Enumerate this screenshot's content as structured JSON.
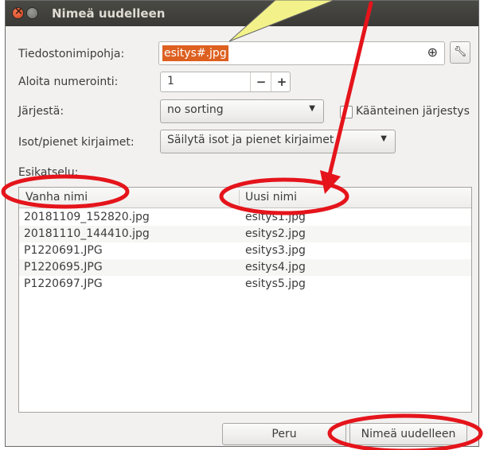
{
  "window": {
    "title": "Nimeä uudelleen"
  },
  "form": {
    "template_label": "Tiedostonimipohja:",
    "template_value": "esitys#.jpg",
    "numbering_label": "Aloita numerointi:",
    "numbering_value": "1",
    "minus": "−",
    "plus": "+",
    "sort_label": "Järjestä:",
    "sort_value": "no sorting",
    "reverse_label": "Käänteinen järjestys",
    "case_label": "Isot/pienet kirjaimet:",
    "case_value": "Säilytä isot ja pienet kirjaimet"
  },
  "preview": {
    "label": "Esikatselu:",
    "columns": [
      "Vanha nimi",
      "Uusi nimi"
    ],
    "rows": [
      {
        "old": "20181109_152820.jpg",
        "new": "esitys1.jpg"
      },
      {
        "old": "20181110_144410.jpg",
        "new": "esitys2.jpg"
      },
      {
        "old": "P1220691.JPG",
        "new": "esitys3.jpg"
      },
      {
        "old": "P1220695.JPG",
        "new": "esitys4.jpg"
      },
      {
        "old": "P1220697.JPG",
        "new": "esitys5.jpg"
      }
    ]
  },
  "buttons": {
    "cancel": "Peru",
    "rename": "Nimeä uudelleen"
  },
  "icons": {
    "template_insert": "globe-icon",
    "template_edit": "wrench-icon",
    "dropdown": "chevron-down-icon"
  },
  "colors": {
    "annotation_red": "#e5141b",
    "callout_yellow": "#f3f28a",
    "selection": "#dd6020"
  }
}
